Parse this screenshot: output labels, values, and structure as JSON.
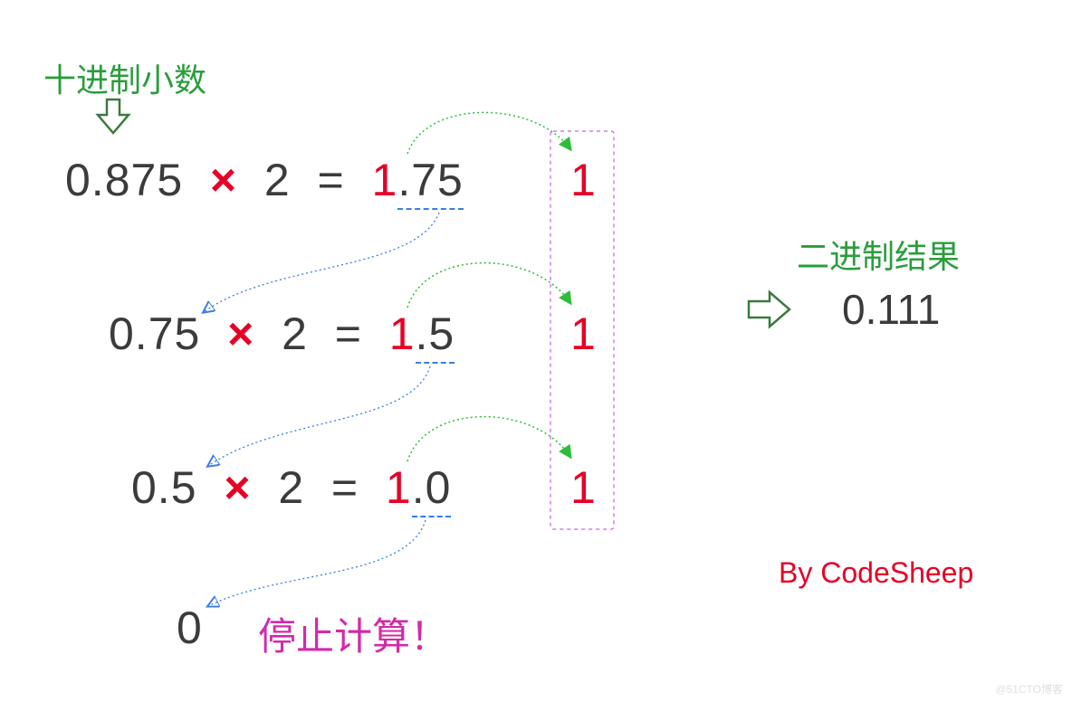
{
  "labels": {
    "decimal_heading": "十进制小数",
    "binary_heading": "二进制结果",
    "stop": "停止计算！",
    "author": "By CodeSheep",
    "watermark": "@51CTO博客"
  },
  "binary_result": "0.111",
  "rows": [
    {
      "operand": "0.875",
      "multiplier": "2",
      "result_int": "1",
      "result_frac": ".75",
      "extracted": "1"
    },
    {
      "operand": "0.75",
      "multiplier": "2",
      "result_int": "1",
      "result_frac": ".5",
      "extracted": "1"
    },
    {
      "operand": "0.5",
      "multiplier": "2",
      "result_int": "1",
      "result_frac": ".0",
      "extracted": "1"
    }
  ],
  "final_operand": "0"
}
